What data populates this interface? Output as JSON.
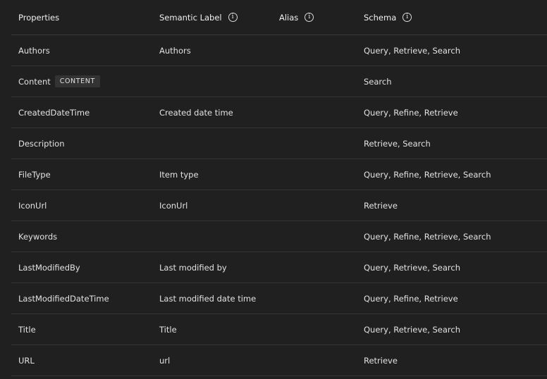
{
  "header": {
    "properties": "Properties",
    "semantic_label": "Semantic Label",
    "alias": "Alias",
    "schema": "Schema",
    "info_glyph": "i"
  },
  "rows": [
    {
      "property": "Authors",
      "badge": "",
      "semantic_label": "Authors",
      "alias": "",
      "schema": "Query, Retrieve, Search"
    },
    {
      "property": "Content",
      "badge": "CONTENT",
      "semantic_label": "",
      "alias": "",
      "schema": "Search"
    },
    {
      "property": "CreatedDateTime",
      "badge": "",
      "semantic_label": "Created date time",
      "alias": "",
      "schema": "Query, Refine, Retrieve"
    },
    {
      "property": "Description",
      "badge": "",
      "semantic_label": "",
      "alias": "",
      "schema": "Retrieve, Search"
    },
    {
      "property": "FileType",
      "badge": "",
      "semantic_label": "Item type",
      "alias": "",
      "schema": "Query, Refine, Retrieve, Search"
    },
    {
      "property": "IconUrl",
      "badge": "",
      "semantic_label": "IconUrl",
      "alias": "",
      "schema": "Retrieve"
    },
    {
      "property": "Keywords",
      "badge": "",
      "semantic_label": "",
      "alias": "",
      "schema": "Query, Refine, Retrieve, Search"
    },
    {
      "property": "LastModifiedBy",
      "badge": "",
      "semantic_label": "Last modified by",
      "alias": "",
      "schema": "Query, Retrieve, Search"
    },
    {
      "property": "LastModifiedDateTime",
      "badge": "",
      "semantic_label": "Last modified date time",
      "alias": "",
      "schema": "Query, Refine, Retrieve"
    },
    {
      "property": "Title",
      "badge": "",
      "semantic_label": "Title",
      "alias": "",
      "schema": "Query, Retrieve, Search"
    },
    {
      "property": "URL",
      "badge": "",
      "semantic_label": "url",
      "alias": "",
      "schema": "Retrieve"
    }
  ]
}
